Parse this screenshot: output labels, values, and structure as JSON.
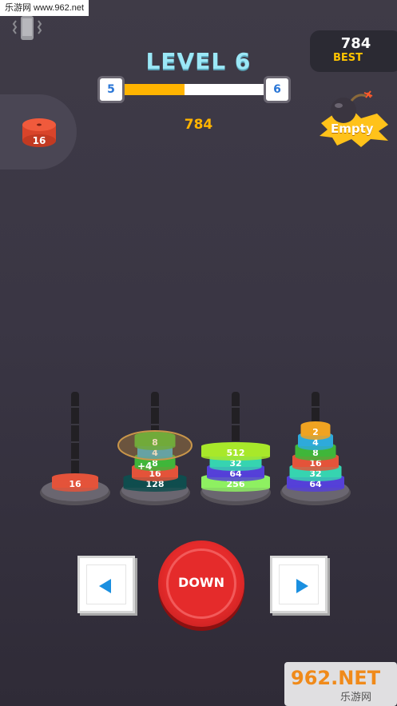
{
  "watermark_top": "乐游网 www.962.net",
  "level": {
    "title": "LEVEL 6",
    "current": "5",
    "next": "6",
    "progress": 0.43
  },
  "score": "784",
  "best": {
    "score": "784",
    "label": "BEST"
  },
  "bomb": {
    "label": "Empty"
  },
  "held_disc": {
    "value": "16"
  },
  "towers": [
    {
      "discs": [
        "16"
      ]
    },
    {
      "discs": [
        "128",
        "16",
        "8",
        "4",
        "8"
      ],
      "bonus": "+4"
    },
    {
      "discs": [
        "256",
        "64",
        "32",
        "512"
      ]
    },
    {
      "discs": [
        "64",
        "32",
        "16",
        "8",
        "4",
        "2"
      ]
    }
  ],
  "controls": {
    "down_label": "DOWN"
  },
  "watermark_bottom": {
    "brand": "962.NET",
    "sub": "乐游网"
  },
  "colors": {
    "accent": "#ffb400",
    "down_button": "#e52b2b",
    "arrow": "#1a8fe0"
  }
}
